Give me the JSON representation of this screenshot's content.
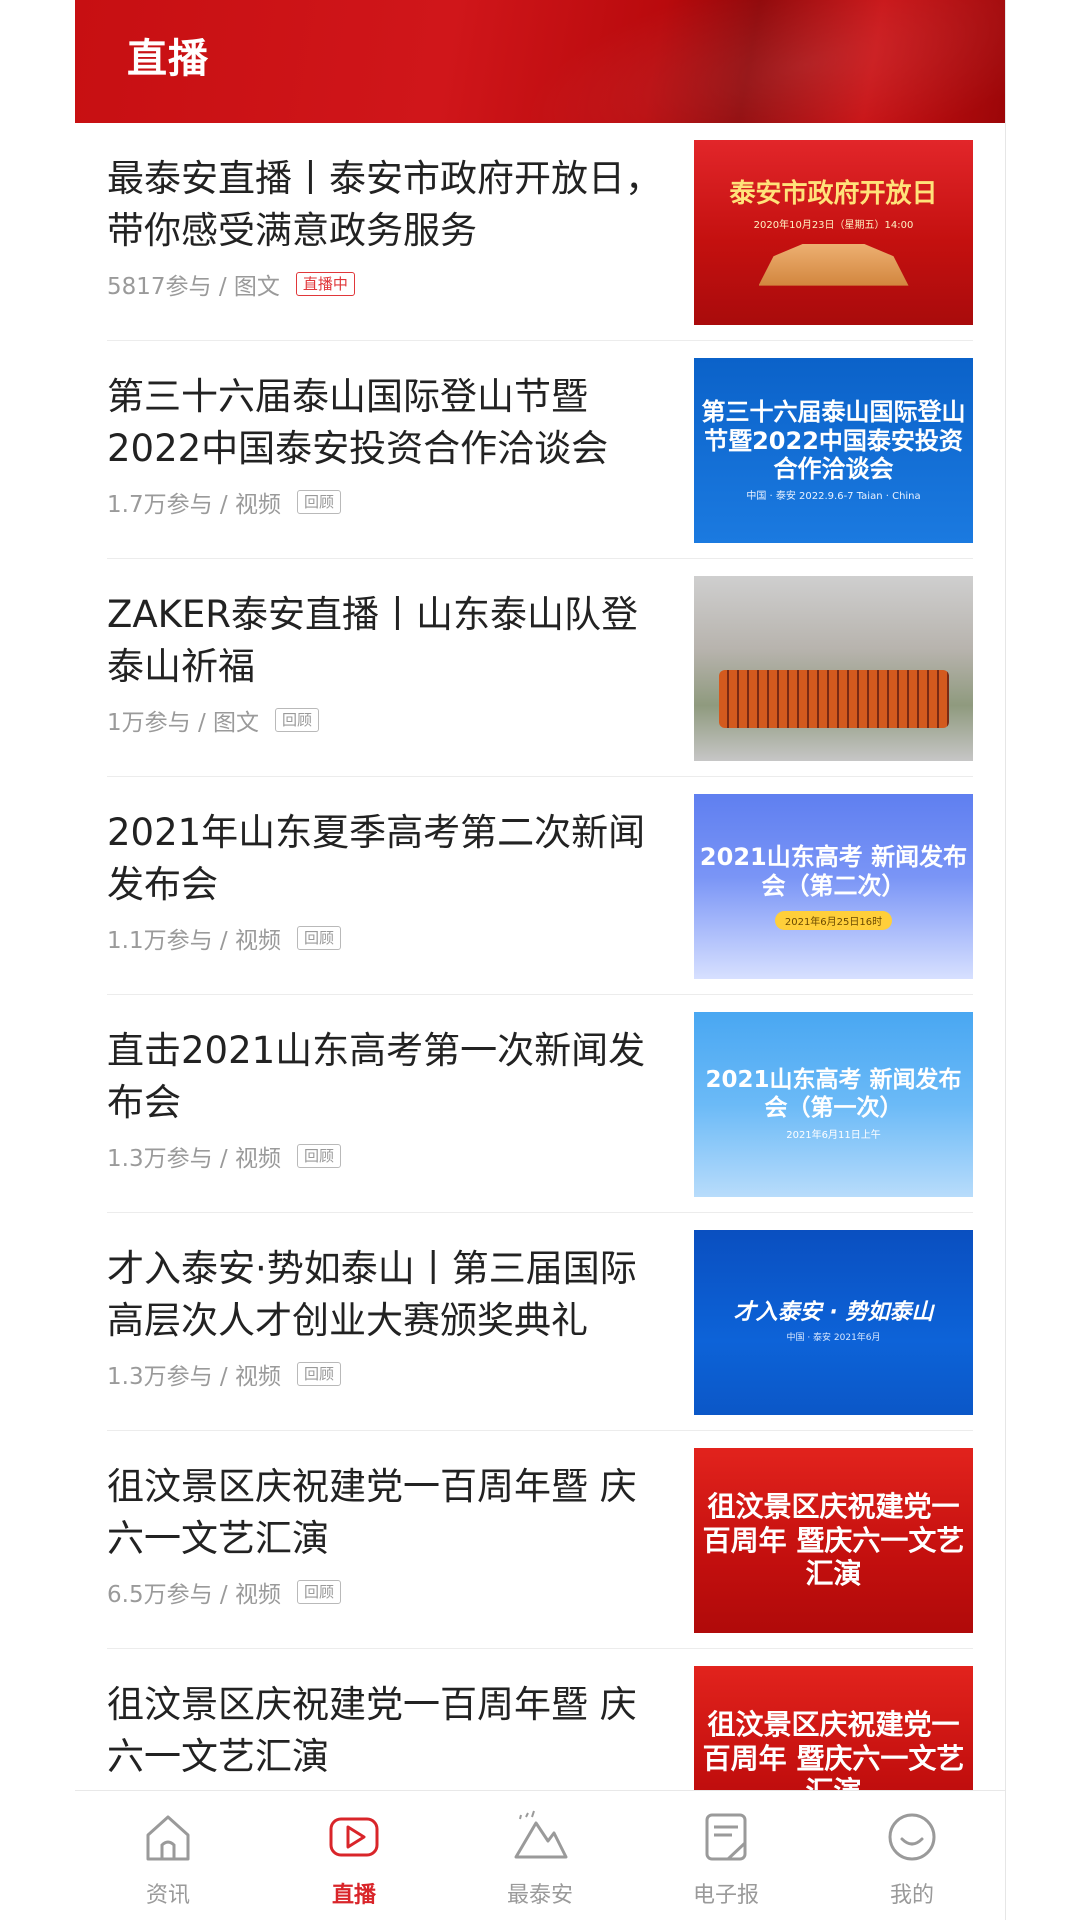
{
  "header": {
    "title": "直播"
  },
  "list": [
    {
      "title": "最泰安直播丨泰安市政府开放日，带你感受满意政务服务",
      "meta": "5817参与 / 图文",
      "badge": "直播中",
      "thumb": {
        "style": "red",
        "t1": "泰安市政府开放日",
        "t2": "2020年10月23日（星期五）14:00"
      }
    },
    {
      "title": "第三十六届泰山国际登山节暨2022中国泰安投资合作洽谈会",
      "meta": "1.7万参与 / 视频",
      "badge": "回顾",
      "thumb": {
        "style": "blue",
        "t1": "第三十六届泰山国际登山节暨2022中国泰安投资合作洽谈会",
        "t2": "中国 · 泰安 2022.9.6-7 Taian · China"
      }
    },
    {
      "title": "ZAKER泰安直播丨山东泰山队登泰山祈福",
      "meta": "1万参与 / 图文",
      "badge": "回顾",
      "thumb": {
        "style": "photo",
        "t1": "",
        "t2": ""
      }
    },
    {
      "title": "2021年山东夏季高考第二次新闻发布会",
      "meta": "1.1万参与 / 视频",
      "badge": "回顾",
      "thumb": {
        "style": "sky",
        "t1": "2021山东高考 新闻发布会（第二次）",
        "t2": "2021年6月25日16时",
        "pill": "2021年6月25日16时"
      }
    },
    {
      "title": "直击2021山东高考第一次新闻发布会",
      "meta": "1.3万参与 / 视频",
      "badge": "回顾",
      "thumb": {
        "style": "diamond",
        "t1": "2021山东高考 新闻发布会（第一次）",
        "t2": "2021年6月11日上午"
      }
    },
    {
      "title": "才入泰安·势如泰山丨第三届国际高层次人才创业大赛颁奖典礼",
      "meta": "1.3万参与 / 视频",
      "badge": "回顾",
      "thumb": {
        "style": "navy",
        "t1": "才入泰安 · 势如泰山",
        "t2": "中国 · 泰安  2021年6月"
      }
    },
    {
      "title": "徂汶景区庆祝建党一百周年暨 庆六一文艺汇演",
      "meta": "6.5万参与 / 视频",
      "badge": "回顾",
      "thumb": {
        "style": "redflag",
        "t1": "徂汶景区庆祝建党一百周年 暨庆六一文艺汇演",
        "t2": ""
      }
    },
    {
      "title": "徂汶景区庆祝建党一百周年暨 庆六一文艺汇演",
      "meta": "",
      "badge": "",
      "thumb": {
        "style": "redflag",
        "t1": "徂汶景区庆祝建党一百周年 暨庆六一文艺汇演",
        "t2": ""
      }
    }
  ],
  "bottom_nav": [
    {
      "label": "资讯",
      "icon": "home-icon",
      "active": false
    },
    {
      "label": "直播",
      "icon": "live-icon",
      "active": true
    },
    {
      "label": "最泰安",
      "icon": "mountain-icon",
      "active": false
    },
    {
      "label": "电子报",
      "icon": "newspaper-icon",
      "active": false
    },
    {
      "label": "我的",
      "icon": "profile-icon",
      "active": false
    }
  ],
  "colors": {
    "brand_red": "#d9252a",
    "inactive": "#9a9a9a"
  }
}
